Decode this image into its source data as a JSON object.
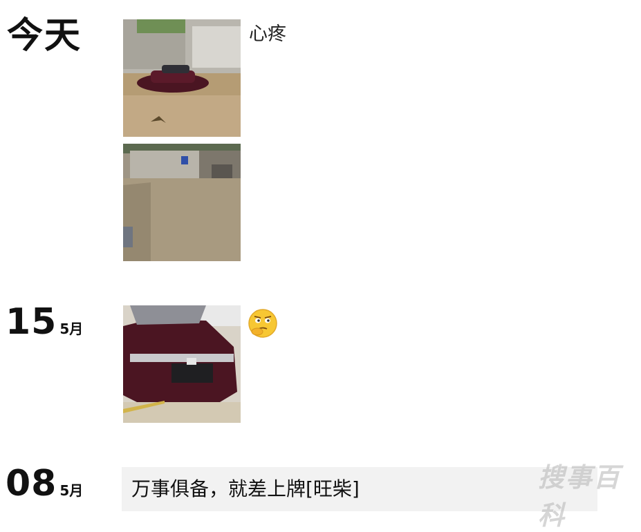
{
  "posts": [
    {
      "date_label": "今天",
      "caption": "心疼",
      "photos": [
        "flooded-street-with-car-photo",
        "flooded-alley-photo"
      ]
    },
    {
      "day": "15",
      "month": "5月",
      "emoji": "thinking-face-emoji",
      "photos": [
        "red-honda-car-front-photo"
      ]
    },
    {
      "day": "08",
      "month": "5月",
      "text": "万事俱备，就差上牌[旺柴]"
    }
  ],
  "watermark": "搜事百科",
  "colors": {
    "background": "#ffffff",
    "text": "#111111",
    "text_post_bg": "#f2f2f2"
  }
}
